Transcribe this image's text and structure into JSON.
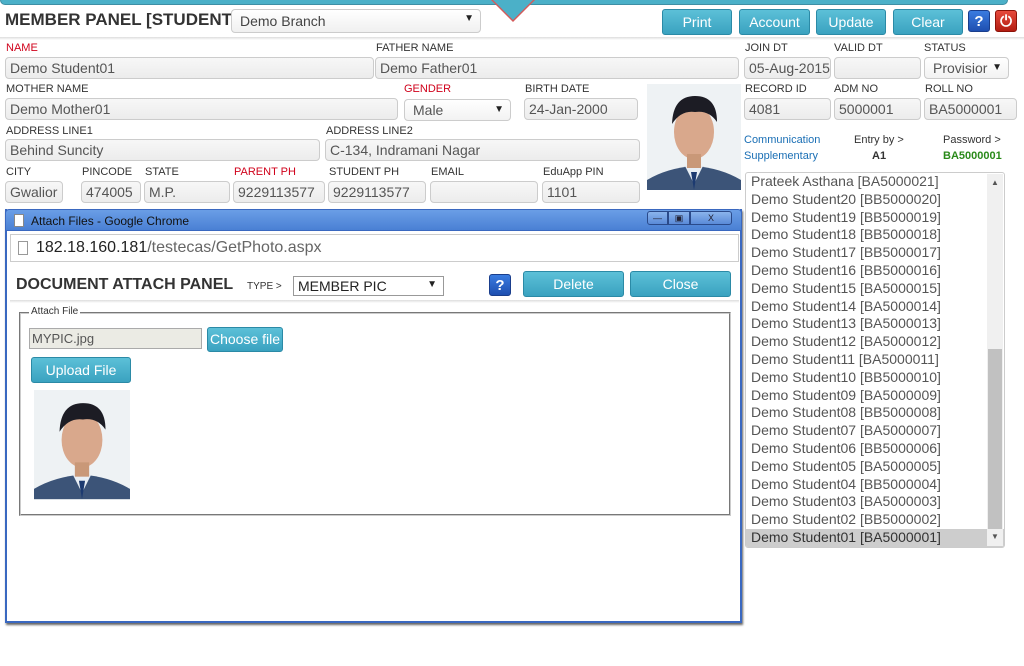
{
  "header": {
    "title": "MEMBER PANEL [STUDENT]",
    "branch_select": "Demo Branch",
    "buttons": {
      "print": "Print",
      "account": "Account",
      "update": "Update",
      "clear": "Clear"
    },
    "help_icon": "?",
    "power_icon": "⏻"
  },
  "form": {
    "name": {
      "label": "NAME",
      "value": "Demo Student01"
    },
    "father_name": {
      "label": "FATHER NAME",
      "value": "Demo Father01"
    },
    "join_dt": {
      "label": "JOIN DT",
      "value": "05-Aug-2015"
    },
    "valid_dt": {
      "label": "VALID DT",
      "value": ""
    },
    "status": {
      "label": "STATUS",
      "value": "Provisior"
    },
    "mother_name": {
      "label": "MOTHER NAME",
      "value": "Demo Mother01"
    },
    "gender": {
      "label": "GENDER",
      "value": "Male"
    },
    "birth_date": {
      "label": "BIRTH DATE",
      "value": "24-Jan-2000"
    },
    "record_id": {
      "label": "RECORD ID",
      "value": "4081"
    },
    "adm_no": {
      "label": "ADM NO",
      "value": "5000001"
    },
    "roll_no": {
      "label": "ROLL NO",
      "value": "BA5000001"
    },
    "address1": {
      "label": "ADDRESS LINE1",
      "value": "Behind Suncity"
    },
    "address2": {
      "label": "ADDRESS LINE2",
      "value": "C-134, Indramani Nagar"
    },
    "city": {
      "label": "CITY",
      "value": "Gwalior"
    },
    "pincode": {
      "label": "PINCODE",
      "value": "474005"
    },
    "state": {
      "label": "STATE",
      "value": "M.P."
    },
    "parent_ph": {
      "label": "PARENT PH",
      "value": "9229113577"
    },
    "student_ph": {
      "label": "STUDENT PH",
      "value": "9229113577"
    },
    "email": {
      "label": "EMAIL",
      "value": ""
    },
    "eduapp_pin": {
      "label": "EduApp PIN",
      "value": "1101"
    }
  },
  "info": {
    "communication": "Communication",
    "supplementary": "Supplementary",
    "entry_by_label": "Entry by >",
    "entry_by_value": "A1",
    "password_label": "Password >",
    "password_value": "BA5000001"
  },
  "student_list": [
    "Prateek Asthana [BA5000021]",
    "Demo Student20 [BB5000020]",
    "Demo Student19 [BB5000019]",
    "Demo Student18 [BB5000018]",
    "Demo Student17 [BB5000017]",
    "Demo Student16 [BB5000016]",
    "Demo Student15 [BA5000015]",
    "Demo Student14 [BA5000014]",
    "Demo Student13 [BA5000013]",
    "Demo Student12 [BA5000012]",
    "Demo Student11 [BA5000011]",
    "Demo Student10 [BB5000010]",
    "Demo Student09 [BA5000009]",
    "Demo Student08 [BB5000008]",
    "Demo Student07 [BA5000007]",
    "Demo Student06 [BB5000006]",
    "Demo Student05 [BA5000005]",
    "Demo Student04 [BB5000004]",
    "Demo Student03 [BA5000003]",
    "Demo Student02 [BB5000002]",
    "Demo Student01 [BA5000001]"
  ],
  "selected_student_index": 20,
  "popup": {
    "window_title": "Attach Files - Google Chrome",
    "url_host": "182.18.160.181",
    "url_path": "/testecas/GetPhoto.aspx",
    "panel_title": "DOCUMENT ATTACH PANEL",
    "type_label": "TYPE >",
    "type_value": "MEMBER PIC",
    "delete_label": "Delete",
    "close_label": "Close",
    "help_icon": "?",
    "fieldset_legend": "Attach File",
    "file_name": "MYPIC.jpg",
    "choose_file_label": "Choose file",
    "upload_label": "Upload File",
    "min_icon": "—",
    "max_icon": "▣",
    "close_icon": "X"
  }
}
